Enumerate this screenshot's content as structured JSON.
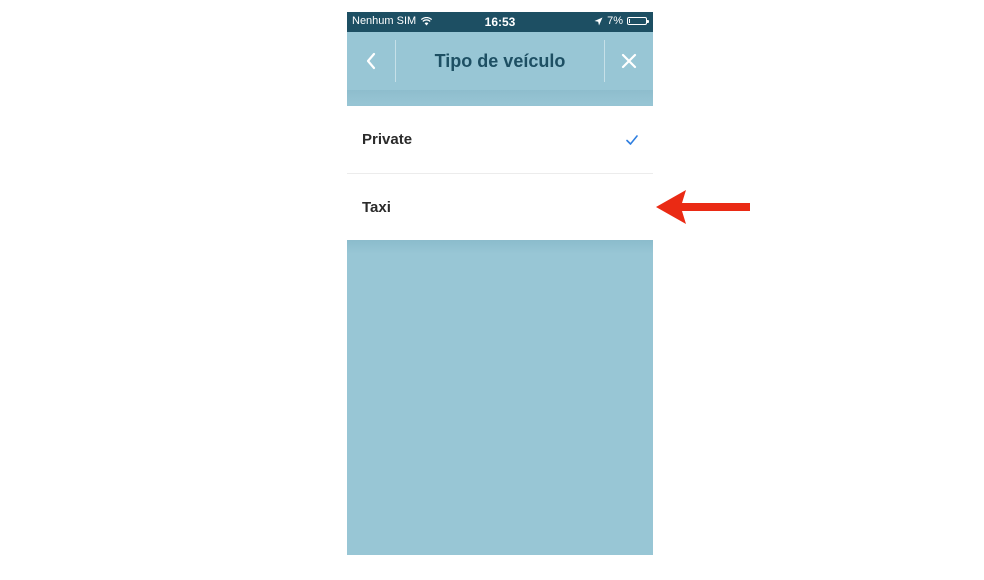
{
  "status_bar": {
    "carrier": "Nenhum SIM",
    "time": "16:53",
    "battery": "7%",
    "battery_level": 0.07
  },
  "nav": {
    "title": "Tipo de veículo"
  },
  "options": [
    {
      "label": "Private",
      "selected": true
    },
    {
      "label": "Taxi",
      "selected": false
    }
  ],
  "colors": {
    "status_bar_bg": "#1d4f63",
    "nav_bg": "#98c6d5",
    "title_color": "#1d4f63",
    "check_color": "#2f7fe0",
    "arrow_color": "#ea2a14"
  }
}
